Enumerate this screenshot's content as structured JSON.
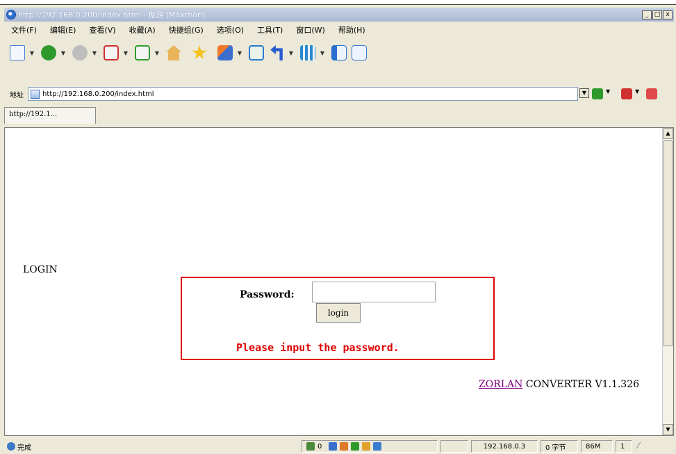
{
  "window": {
    "title": "http://192.168.0.200/index.html - 傲游 [Maxthon]",
    "controls": [
      "_",
      "□",
      "x"
    ]
  },
  "menu": [
    "文件(F)",
    "编辑(E)",
    "查看(V)",
    "收藏(A)",
    "快捷组(G)",
    "选项(O)",
    "工具(T)",
    "窗口(W)",
    "帮助(H)"
  ],
  "toolbar": [
    {
      "icon": "new-page-icon",
      "color": "#4a7fd6"
    },
    {
      "icon": "back-icon",
      "color": "#2e9a2e"
    },
    {
      "icon": "forward-icon",
      "color": "#9a9a9a"
    },
    {
      "icon": "stop-icon",
      "color": "#d03030"
    },
    {
      "icon": "refresh-icon",
      "color": "#2e9a2e"
    },
    {
      "icon": "home-icon",
      "color": "#d07a2a"
    },
    {
      "icon": "favorites-star-icon",
      "color": "#f2c21a"
    },
    {
      "icon": "group-icon",
      "color": "#3a6fd0"
    },
    {
      "icon": "chart-icon",
      "color": "#2a7ad0"
    },
    {
      "icon": "undo-icon",
      "color": "#2a5ad0"
    },
    {
      "icon": "columns-icon",
      "color": "#2a8ad0"
    },
    {
      "icon": "sidebar-icon",
      "color": "#2a6fd0"
    },
    {
      "icon": "edit-icon",
      "color": "#3a7ad0"
    }
  ],
  "address": {
    "label": "地址",
    "url": "http://192.168.0.200/index.html"
  },
  "tab": {
    "label": "http://192.1..."
  },
  "page": {
    "heading": "LOGIN",
    "password_label": "Password:",
    "password_value": "",
    "login_button": "login",
    "message": "Please input the password.",
    "brand_link": "ZORLAN",
    "version": " CONVERTER V1.1.326"
  },
  "status": {
    "text": "完成",
    "zero": "0",
    "ip": "192.168.0.3",
    "bytes": "0 字节",
    "mem": "86M",
    "count": "1"
  },
  "colors": {
    "accent_red": "#e00000",
    "link_visited": "#800080"
  }
}
